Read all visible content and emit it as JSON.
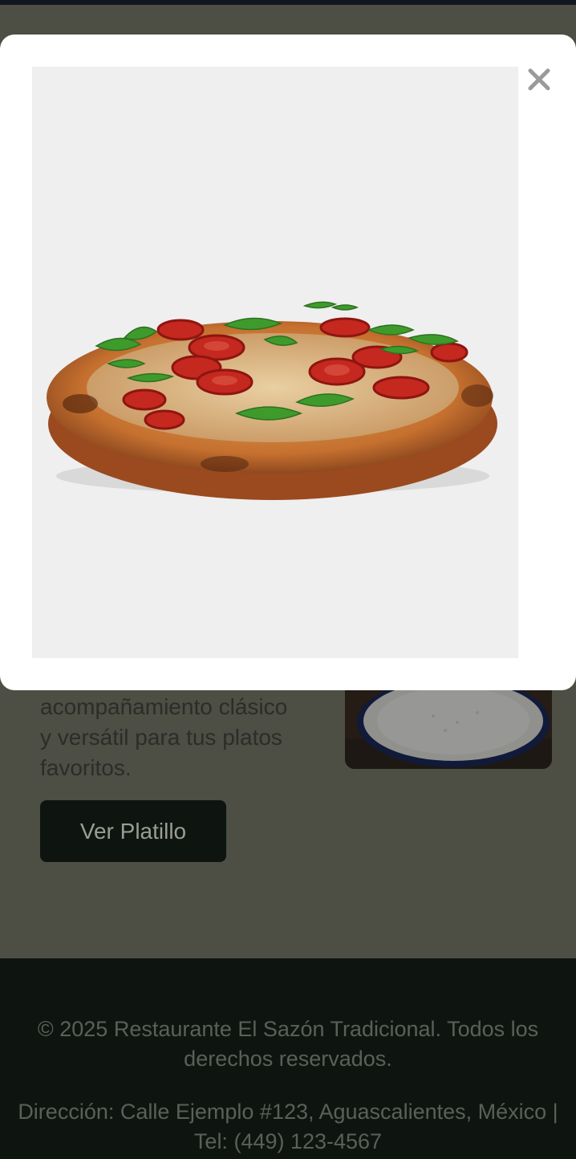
{
  "background": {
    "dish": {
      "description_lines": [
        "acompañamiento clásico",
        "y versátil para tus platos",
        "favoritos."
      ],
      "image_icon": "rice-bowl-photo",
      "button_label": "Ver Platillo"
    },
    "footer": {
      "copyright": "© 2025 Restaurante El Sazón Tradicional. Todos los derechos reservados.",
      "address": "Dirección: Calle Ejemplo #123, Aguascalientes, México | Tel: (449) 123-4567"
    }
  },
  "modal": {
    "image_icon": "pizza-photo",
    "close_label": "×",
    "close_icon": "close-icon"
  },
  "colors": {
    "overlay_bg": "#4d4e44",
    "footer_bg": "#0e1510",
    "button_bg": "#0e1510",
    "modal_bg": "#ffffff",
    "image_bg": "#efefef"
  }
}
